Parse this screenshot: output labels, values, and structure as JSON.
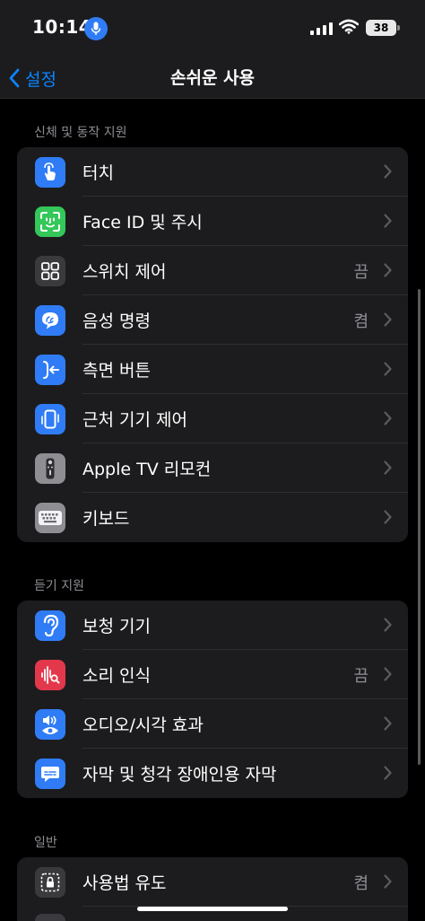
{
  "status_bar": {
    "time": "10:14",
    "battery": "38"
  },
  "nav": {
    "back_label": "설정",
    "title": "손쉬운 사용"
  },
  "sections": [
    {
      "header": "신체 및 동작 지원",
      "items": [
        {
          "label": "터치",
          "value": "",
          "icon": "hand-touch-icon",
          "color": "#2f7cf6"
        },
        {
          "label": "Face ID 및 주시",
          "value": "",
          "icon": "face-id-icon",
          "color": "#34c759"
        },
        {
          "label": "스위치 제어",
          "value": "끔",
          "icon": "switch-control-icon",
          "color": "#3a3a3c"
        },
        {
          "label": "음성 명령",
          "value": "켬",
          "icon": "voice-control-icon",
          "color": "#2f7cf6"
        },
        {
          "label": "측면 버튼",
          "value": "",
          "icon": "side-button-icon",
          "color": "#2f7cf6"
        },
        {
          "label": "근처 기기 제어",
          "value": "",
          "icon": "nearby-devices-icon",
          "color": "#2f7cf6"
        },
        {
          "label": "Apple TV 리모컨",
          "value": "",
          "icon": "tv-remote-icon",
          "color": "#8e8e93"
        },
        {
          "label": "키보드",
          "value": "",
          "icon": "keyboard-icon",
          "color": "#8e8e93"
        }
      ]
    },
    {
      "header": "듣기 지원",
      "items": [
        {
          "label": "보청 기기",
          "value": "",
          "icon": "ear-icon",
          "color": "#2f7cf6"
        },
        {
          "label": "소리 인식",
          "value": "끔",
          "icon": "sound-recognition-icon",
          "color": "#e3384b"
        },
        {
          "label": "오디오/시각 효과",
          "value": "",
          "icon": "audio-visual-icon",
          "color": "#2f7cf6"
        },
        {
          "label": "자막 및 청각 장애인용 자막",
          "value": "",
          "icon": "subtitles-icon",
          "color": "#2f7cf6"
        }
      ]
    },
    {
      "header": "일반",
      "items": [
        {
          "label": "사용법 유도",
          "value": "켬",
          "icon": "guided-access-icon",
          "color": "#3a3a3c"
        }
      ]
    }
  ]
}
